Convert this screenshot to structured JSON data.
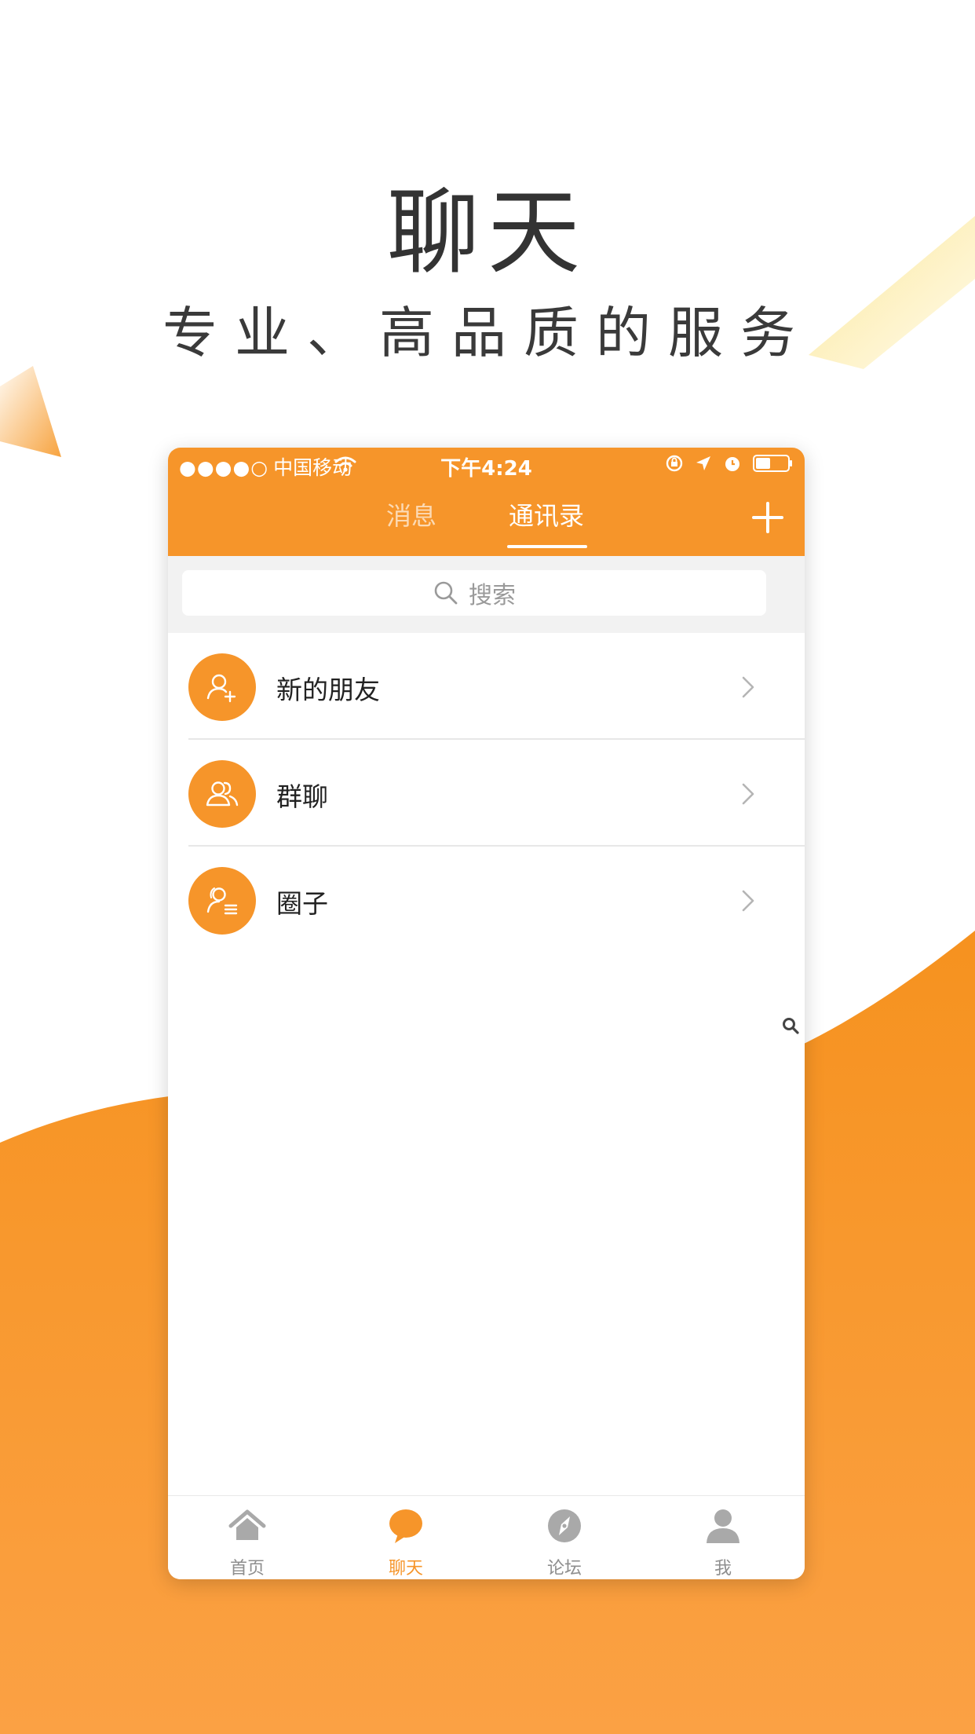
{
  "promo": {
    "title": "聊天",
    "subtitle": "专业、高品质的服务"
  },
  "colors": {
    "accent": "#f6952a",
    "accent_light": "#fbb04f",
    "page_bg": "#ffffff",
    "nav_inactive": "#8e8e8e"
  },
  "status_bar": {
    "signal_dots": "●●●●○",
    "carrier": "中国移动",
    "time": "下午4:24",
    "icons": [
      "wifi-icon",
      "rotation-lock-icon",
      "location-icon",
      "alarm-icon",
      "battery-icon"
    ]
  },
  "header": {
    "tabs": [
      {
        "label": "消息",
        "active": false
      },
      {
        "label": "通讯录",
        "active": true
      }
    ],
    "add_icon": "plus-icon"
  },
  "search": {
    "placeholder": "搜索",
    "icon": "search-icon"
  },
  "contacts": {
    "items": [
      {
        "label": "新的朋友",
        "icon": "add-friend-icon"
      },
      {
        "label": "群聊",
        "icon": "group-chat-icon"
      },
      {
        "label": "圈子",
        "icon": "circle-icon"
      }
    ],
    "index_icon": "search-icon"
  },
  "bottom_nav": {
    "items": [
      {
        "label": "首页",
        "icon": "home-icon",
        "active": false
      },
      {
        "label": "聊天",
        "icon": "chat-bubble-icon",
        "active": true
      },
      {
        "label": "论坛",
        "icon": "compass-icon",
        "active": false
      },
      {
        "label": "我",
        "icon": "person-icon",
        "active": false
      }
    ]
  }
}
